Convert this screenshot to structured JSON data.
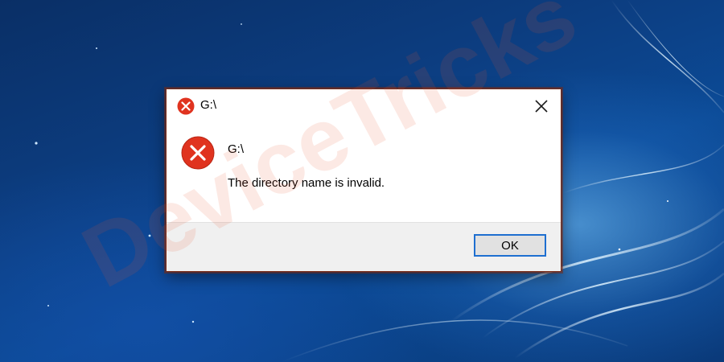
{
  "dialog": {
    "title": "G:\\",
    "heading": "G:\\",
    "message": "The directory name is invalid.",
    "ok_label": "OK",
    "icon": "error-icon",
    "close_icon": "close-icon"
  },
  "watermark": {
    "text": "DeviceTricks"
  },
  "colors": {
    "error_red": "#e0331f",
    "button_focus_border": "#1e6fd0",
    "footer_bg": "#f0f0f0",
    "dialog_border": "#7a2b16",
    "desktop_blue": "#0c3d80"
  }
}
